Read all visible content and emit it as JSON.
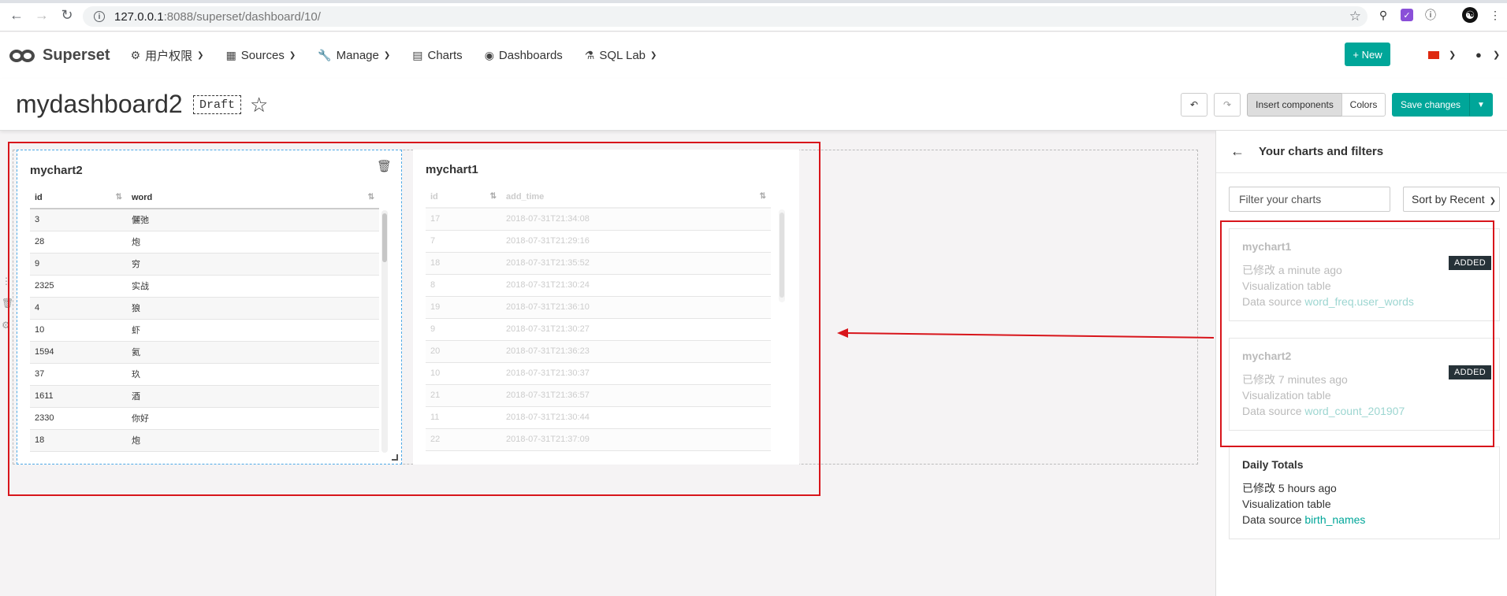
{
  "browser": {
    "url_host": "127.0.0.1",
    "url_rest": ":8088/superset/dashboard/10/"
  },
  "navbar": {
    "brand": "Superset",
    "menus": [
      {
        "label": "用户权限",
        "icon": "cogs-icon"
      },
      {
        "label": "Sources",
        "icon": "table-icon"
      },
      {
        "label": "Manage",
        "icon": "wrench-icon"
      },
      {
        "label": "Charts",
        "icon": "bar-chart-icon"
      },
      {
        "label": "Dashboards",
        "icon": "dashboard-icon"
      },
      {
        "label": "SQL Lab",
        "icon": "flask-icon"
      }
    ],
    "new_button": "+ New"
  },
  "header": {
    "title": "mydashboard2",
    "status": "Draft",
    "insert_components": "Insert components",
    "colors": "Colors",
    "save_changes": "Save changes"
  },
  "charts": [
    {
      "title": "mychart2",
      "columns": [
        "id",
        "word"
      ],
      "rows": [
        [
          "3",
          "儷弛"
        ],
        [
          "28",
          "炮"
        ],
        [
          "9",
          "穷"
        ],
        [
          "2325",
          "实战"
        ],
        [
          "4",
          "狼"
        ],
        [
          "10",
          "虾"
        ],
        [
          "1594",
          "氦"
        ],
        [
          "37",
          "玖"
        ],
        [
          "1611",
          "酒"
        ],
        [
          "2330",
          "你好"
        ],
        [
          "18",
          "炮"
        ]
      ]
    },
    {
      "title": "mychart1",
      "columns": [
        "id",
        "add_time"
      ],
      "rows": [
        [
          "17",
          "2018-07-31T21:34:08"
        ],
        [
          "7",
          "2018-07-31T21:29:16"
        ],
        [
          "18",
          "2018-07-31T21:35:52"
        ],
        [
          "8",
          "2018-07-31T21:30:24"
        ],
        [
          "19",
          "2018-07-31T21:36:10"
        ],
        [
          "9",
          "2018-07-31T21:30:27"
        ],
        [
          "20",
          "2018-07-31T21:36:23"
        ],
        [
          "10",
          "2018-07-31T21:30:37"
        ],
        [
          "21",
          "2018-07-31T21:36:57"
        ],
        [
          "11",
          "2018-07-31T21:30:44"
        ],
        [
          "22",
          "2018-07-31T21:37:09"
        ]
      ]
    }
  ],
  "panel": {
    "title": "Your charts and filters",
    "filter_placeholder": "Filter your charts",
    "sort_label": "Sort by Recent",
    "items": [
      {
        "name": "mychart1",
        "modified_label": "已修改",
        "modified": "a minute ago",
        "viz_label": "Visualization",
        "viz": "table",
        "ds_label": "Data source",
        "datasource": "word_freq.user_words",
        "badge": "ADDED"
      },
      {
        "name": "mychart2",
        "modified_label": "已修改",
        "modified": "7 minutes ago",
        "viz_label": "Visualization",
        "viz": "table",
        "ds_label": "Data source",
        "datasource": "word_count_201907",
        "badge": "ADDED"
      },
      {
        "name": "Daily Totals",
        "modified_label": "已修改",
        "modified": "5 hours ago",
        "viz_label": "Visualization",
        "viz": "table",
        "ds_label": "Data source",
        "datasource": "birth_names",
        "badge": ""
      }
    ]
  },
  "colors": {
    "accent": "#00a699",
    "annotation_red": "#d8151b",
    "badge_bg": "#263238"
  }
}
